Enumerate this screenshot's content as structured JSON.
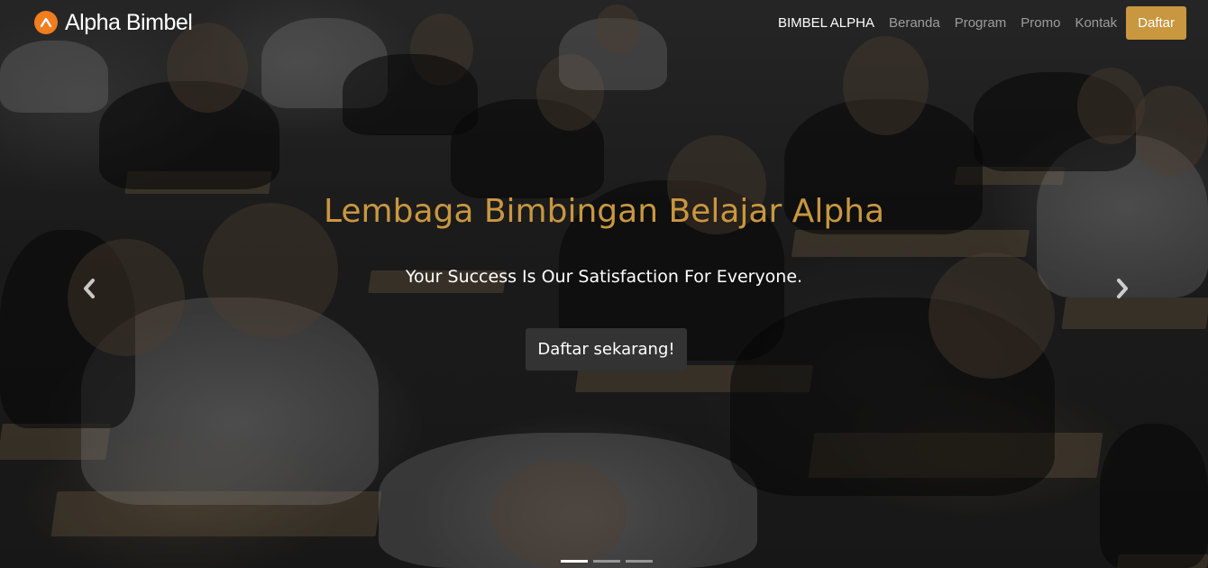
{
  "brand": {
    "name": "Alpha Bimbel",
    "logo_color": "#f07d1e"
  },
  "nav": {
    "items": [
      {
        "label": "BIMBEL ALPHA",
        "active": true
      },
      {
        "label": "Beranda",
        "active": false
      },
      {
        "label": "Program",
        "active": false
      },
      {
        "label": "Promo",
        "active": false
      },
      {
        "label": "Kontak",
        "active": false
      }
    ],
    "cta_label": "Daftar",
    "cta_color": "#c9973f"
  },
  "hero": {
    "title": "Lembaga Bimbingan Belajar Alpha",
    "subtitle": "Your Success Is Our Satisfaction For Everyone.",
    "button_label": "Daftar sekarang!",
    "title_color": "#c9973f"
  },
  "carousel": {
    "prev_icon": "chevron-left-icon",
    "next_icon": "chevron-right-icon",
    "slide_count": 3,
    "active_slide": 1
  }
}
